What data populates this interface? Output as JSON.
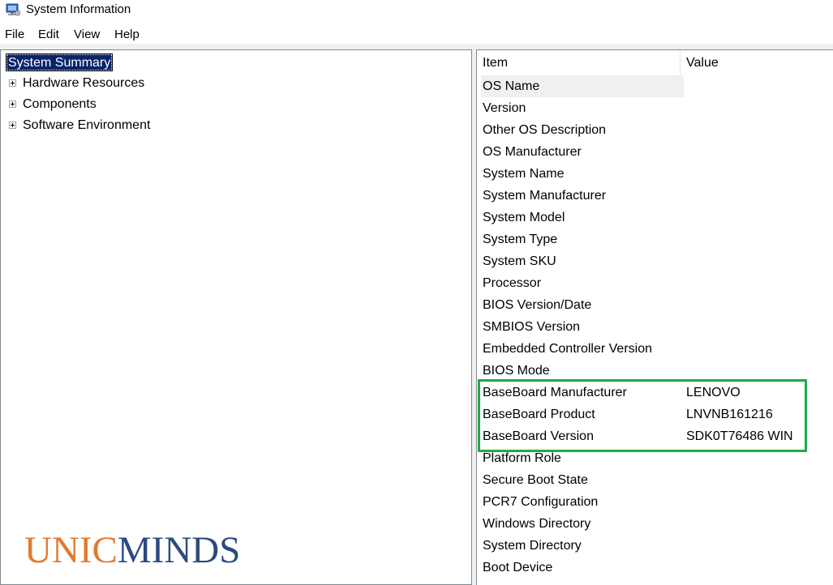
{
  "window": {
    "title": "System Information"
  },
  "menu": {
    "file": "File",
    "edit": "Edit",
    "view": "View",
    "help": "Help"
  },
  "tree": {
    "selected": "System Summary",
    "nodes": [
      {
        "label": "Hardware Resources"
      },
      {
        "label": "Components"
      },
      {
        "label": "Software Environment"
      }
    ]
  },
  "table": {
    "headers": {
      "item": "Item",
      "value": "Value"
    },
    "rows": [
      {
        "item": "OS Name",
        "value": ""
      },
      {
        "item": "Version",
        "value": ""
      },
      {
        "item": "Other OS Description",
        "value": ""
      },
      {
        "item": "OS Manufacturer",
        "value": ""
      },
      {
        "item": "System Name",
        "value": ""
      },
      {
        "item": "System Manufacturer",
        "value": ""
      },
      {
        "item": "System Model",
        "value": ""
      },
      {
        "item": "System Type",
        "value": ""
      },
      {
        "item": "System SKU",
        "value": ""
      },
      {
        "item": "Processor",
        "value": ""
      },
      {
        "item": "BIOS Version/Date",
        "value": ""
      },
      {
        "item": "SMBIOS Version",
        "value": ""
      },
      {
        "item": "Embedded Controller Version",
        "value": ""
      },
      {
        "item": "BIOS Mode",
        "value": ""
      },
      {
        "item": "BaseBoard Manufacturer",
        "value": "LENOVO"
      },
      {
        "item": "BaseBoard Product",
        "value": "LNVNB161216"
      },
      {
        "item": "BaseBoard Version",
        "value": "SDK0T76486 WIN"
      },
      {
        "item": "Platform Role",
        "value": ""
      },
      {
        "item": "Secure Boot State",
        "value": ""
      },
      {
        "item": "PCR7 Configuration",
        "value": ""
      },
      {
        "item": "Windows Directory",
        "value": ""
      },
      {
        "item": "System Directory",
        "value": ""
      },
      {
        "item": "Boot Device",
        "value": ""
      }
    ]
  },
  "logo": {
    "part1": "UNIC",
    "part2": "MINDS"
  },
  "colors": {
    "highlight_box": "#22a84a",
    "logo_orange": "#e07a2e",
    "logo_navy": "#2a4a7f",
    "tree_selection": "#0a246a"
  },
  "icons": {
    "app": "system-information-icon"
  }
}
